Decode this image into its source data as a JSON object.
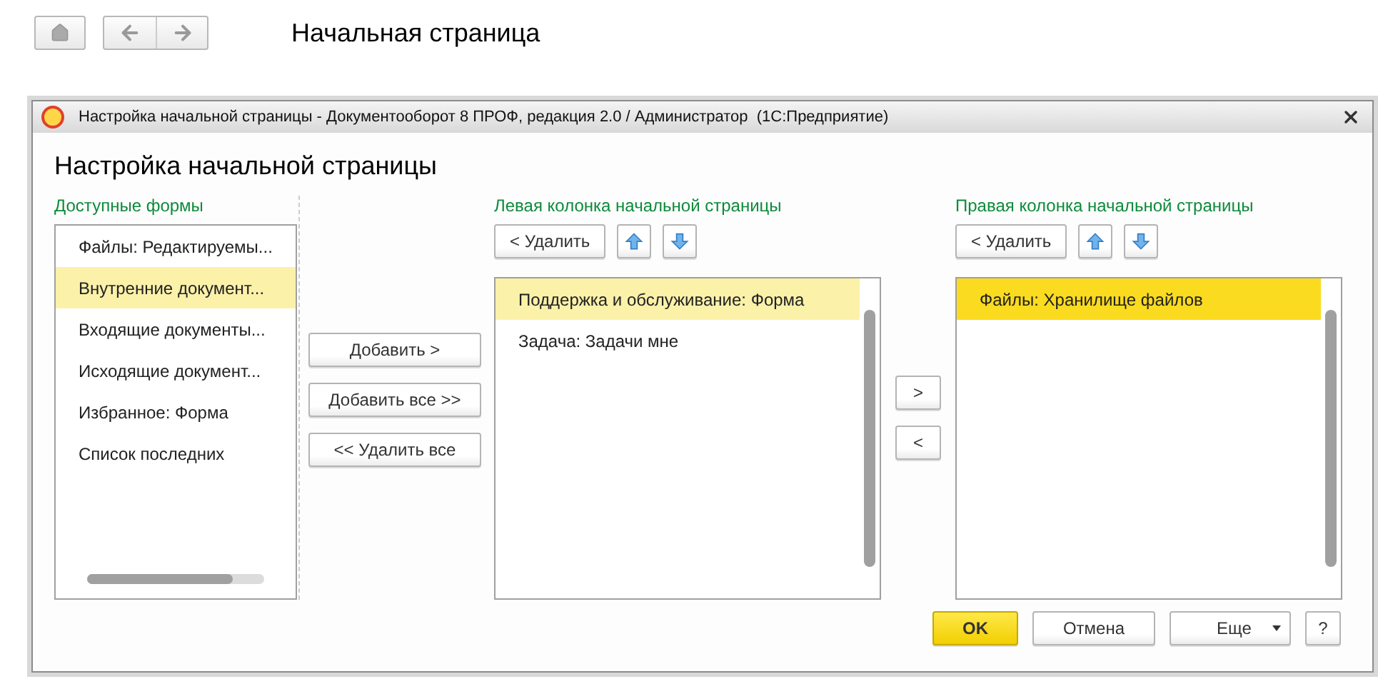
{
  "page": {
    "title": "Начальная страница"
  },
  "dialog": {
    "window_title": "Настройка начальной страницы - Документооборот 8 ПРОФ, редакция 2.0 / Администратор  (1С:Предприятие)",
    "heading": "Настройка начальной страницы",
    "available": {
      "label": "Доступные формы",
      "focused": false,
      "items": [
        {
          "label": "Файлы: Редактируемы...",
          "selected": false
        },
        {
          "label": "Внутренние документ...",
          "selected": true
        },
        {
          "label": "Входящие документы...",
          "selected": false
        },
        {
          "label": "Исходящие документ...",
          "selected": false
        },
        {
          "label": "Избранное: Форма",
          "selected": false
        },
        {
          "label": "Список последних",
          "selected": false
        }
      ]
    },
    "transfer_buttons": [
      "Добавить >",
      "Добавить все >>",
      "<< Удалить все"
    ],
    "columns": [
      {
        "label": "Левая колонка начальной страницы",
        "remove_button": "< Удалить",
        "focused": false,
        "items": [
          {
            "label": "Поддержка и обслуживание: Форма",
            "selected": true
          },
          {
            "label": "Задача: Задачи мне",
            "selected": false
          }
        ]
      },
      {
        "label": "Правая колонка начальной страницы",
        "remove_button": "< Удалить",
        "focused": true,
        "items": [
          {
            "label": "Файлы: Хранилище файлов",
            "selected": true
          }
        ]
      }
    ],
    "move_buttons": [
      ">",
      "<"
    ],
    "footer": {
      "ok": "OK",
      "cancel": "Отмена",
      "more": "Еще",
      "help": "?"
    }
  }
}
